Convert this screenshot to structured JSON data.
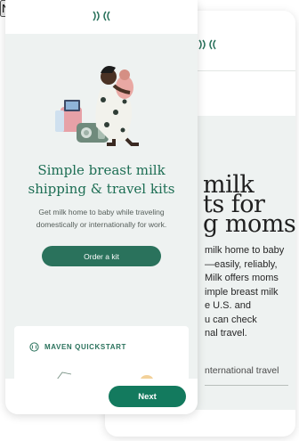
{
  "colors": {
    "brand_green": "#137a5e",
    "headline_green": "#1d6e54",
    "panel_bg": "#eef2f1"
  },
  "back_screen": {
    "logo_icon": "maven-logo-icon",
    "title_lines": [
      "milk",
      "ts for",
      "g moms"
    ],
    "body_lines": [
      "milk home to baby",
      "—easily, reliably,",
      "Milk offers moms",
      "imple breast milk",
      "e U.S. and",
      "u can check",
      "nal travel."
    ],
    "select_text": "nternational travel",
    "next_label": "Next"
  },
  "front_screen": {
    "logo_icon": "maven-logo-icon",
    "illustration": "mother-holding-baby-with-travel-kit-illustration",
    "headline_line1": "Simple breast milk",
    "headline_line2": "shipping & travel kits",
    "subcopy_line1": "Get milk home to baby while traveling",
    "subcopy_line2": "domestically or internationally for work.",
    "order_button": "Order a kit",
    "card": {
      "icon": "maven-circle-icon",
      "label": "MAVEN QUICKSTART"
    },
    "next_label": "Next"
  }
}
